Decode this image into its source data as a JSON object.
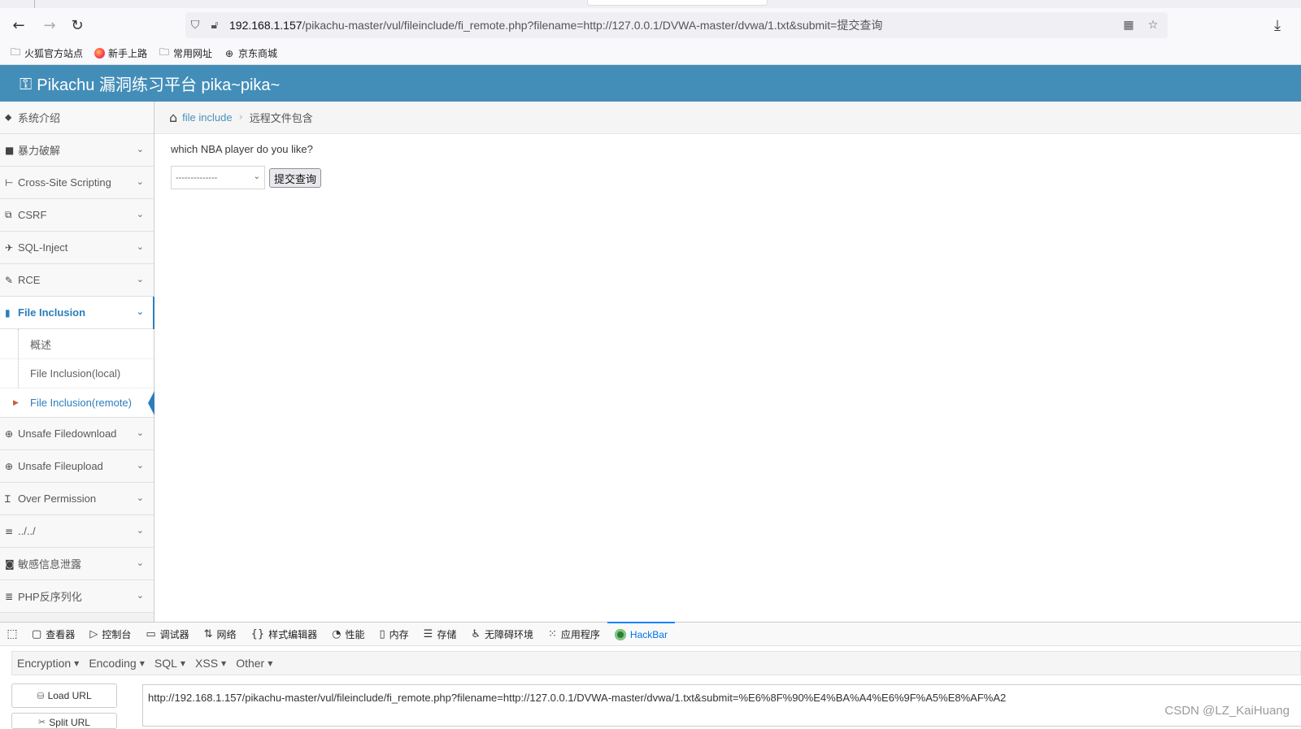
{
  "browser": {
    "url_host": "192.168.1.157",
    "url_path": "/pikachu-master/vul/fileinclude/fi_remote.php?filename=http://127.0.0.1/DVWA-master/dvwa/1.txt&submit=提交查询",
    "bookmarks": [
      "火狐官方站点",
      "新手上路",
      "常用网址",
      "京东商城"
    ]
  },
  "app": {
    "title": "Pikachu 漏洞练习平台 pika~pika~"
  },
  "sidebar": {
    "items": [
      {
        "label": "系统介绍",
        "icon": "tag-icon"
      },
      {
        "label": "暴力破解",
        "icon": "lock-icon"
      },
      {
        "label": "Cross-Site Scripting",
        "icon": "sitemap-icon"
      },
      {
        "label": "CSRF",
        "icon": "share-icon"
      },
      {
        "label": "SQL-Inject",
        "icon": "plane-icon"
      },
      {
        "label": "RCE",
        "icon": "pencil-icon"
      },
      {
        "label": "File Inclusion",
        "icon": "file-icon"
      },
      {
        "label": "Unsafe Filedownload",
        "icon": "download-icon"
      },
      {
        "label": "Unsafe Fileupload",
        "icon": "upload-icon"
      },
      {
        "label": "Over Permission",
        "icon": "text-height-icon"
      },
      {
        "label": "../../",
        "icon": "align-left-icon"
      },
      {
        "label": "敏感信息泄露",
        "icon": "camera-icon"
      },
      {
        "label": "PHP反序列化",
        "icon": "list-icon"
      }
    ],
    "submenu": [
      "概述",
      "File Inclusion(local)",
      "File Inclusion(remote)"
    ]
  },
  "breadcrumb": {
    "link": "file include",
    "current": "远程文件包含"
  },
  "main": {
    "question": "which NBA player do you like?",
    "select_value": "--------------",
    "submit_label": "提交查询"
  },
  "devtools": {
    "tabs": [
      "查看器",
      "控制台",
      "调试器",
      "网络",
      "样式编辑器",
      "性能",
      "内存",
      "存储",
      "无障碍环境",
      "应用程序",
      "HackBar"
    ],
    "active_tab": "HackBar"
  },
  "hackbar": {
    "menus": [
      "Encryption",
      "Encoding",
      "SQL",
      "XSS",
      "Other"
    ],
    "load_url": "Load URL",
    "split_url": "Split URL",
    "url_value": "http://192.168.1.157/pikachu-master/vul/fileinclude/fi_remote.php?filename=http://127.0.0.1/DVWA-master/dvwa/1.txt&submit=%E6%8F%90%E4%BA%A4%E6%9F%A5%E8%AF%A2"
  },
  "watermark": "CSDN @LZ_KaiHuang",
  "colors": {
    "header": "#438eb9",
    "accent": "#2b7dbc"
  }
}
